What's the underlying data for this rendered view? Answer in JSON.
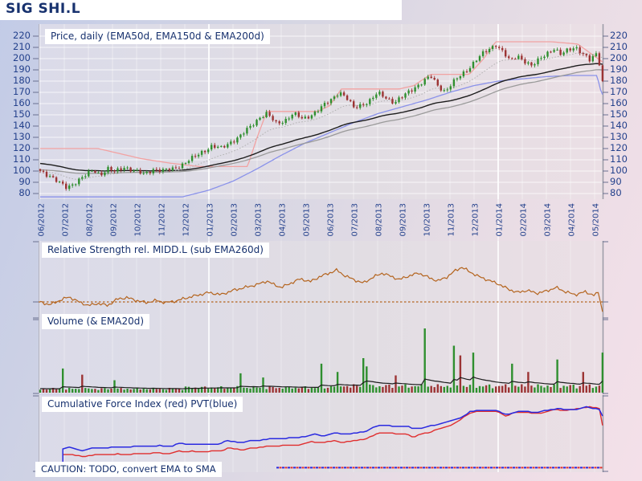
{
  "title": "SIG SHI.L",
  "caution": "CAUTION: TODO, convert EMA to SMA",
  "axis": {
    "months": [
      "06/2012",
      "07/2012",
      "08/2012",
      "09/2012",
      "10/2012",
      "11/2012",
      "12/2012",
      "01/2013",
      "02/2013",
      "03/2013",
      "04/2013",
      "05/2013",
      "06/2013",
      "07/2013",
      "08/2013",
      "09/2013",
      "10/2013",
      "11/2013",
      "12/2013",
      "01/2014",
      "02/2014",
      "03/2014",
      "04/2014",
      "05/2014"
    ],
    "months_span": 23.33,
    "year_boundaries": [
      7,
      19
    ]
  },
  "colors": {
    "up": "#2f8f2f",
    "down": "#9c3434",
    "high_envelope": "#f2a2a2",
    "low_envelope": "#8a92ea",
    "ema50": "#b0b0b0",
    "ema150": "#1d1d1d",
    "ema200": "#9a9a9a",
    "rs_line": "#b4641e",
    "cfi_red": "#e02e2e",
    "pvt_blue": "#2a2ae0",
    "volume_ema": "#1d1d1d",
    "axis_text": "#24418c",
    "label_text": "#17316e"
  },
  "chart_data": [
    {
      "id": "price",
      "type": "candlestick",
      "title": "Price, daily (EMA50d, EMA150d & EMA200d)",
      "ylim": [
        75,
        228
      ],
      "y_ticks": [
        220,
        210,
        200,
        190,
        180,
        170,
        160,
        150,
        140,
        130,
        120,
        110,
        100,
        90,
        80
      ],
      "close_anchors": [
        [
          0,
          100
        ],
        [
          0.4,
          96
        ],
        [
          0.8,
          89
        ],
        [
          1.1,
          85
        ],
        [
          1.5,
          91
        ],
        [
          1.9,
          96
        ],
        [
          2.2,
          101
        ],
        [
          2.5,
          97
        ],
        [
          2.8,
          102
        ],
        [
          3.1,
          99
        ],
        [
          3.5,
          104
        ],
        [
          3.9,
          100
        ],
        [
          4.3,
          97
        ],
        [
          4.7,
          102
        ],
        [
          5.1,
          100
        ],
        [
          5.5,
          102
        ],
        [
          5.9,
          106
        ],
        [
          6.3,
          111
        ],
        [
          6.7,
          117
        ],
        [
          7.1,
          122
        ],
        [
          7.5,
          120
        ],
        [
          7.9,
          126
        ],
        [
          8.3,
          131
        ],
        [
          8.7,
          139
        ],
        [
          9.1,
          148
        ],
        [
          9.4,
          151
        ],
        [
          9.8,
          142
        ],
        [
          10.2,
          146
        ],
        [
          10.5,
          151
        ],
        [
          10.9,
          146
        ],
        [
          11.3,
          151
        ],
        [
          11.7,
          157
        ],
        [
          12.1,
          164
        ],
        [
          12.4,
          171
        ],
        [
          12.7,
          165
        ],
        [
          13.0,
          156
        ],
        [
          13.3,
          159
        ],
        [
          13.7,
          163
        ],
        [
          14.0,
          169
        ],
        [
          14.3,
          166
        ],
        [
          14.7,
          161
        ],
        [
          15.1,
          167
        ],
        [
          15.5,
          174
        ],
        [
          15.9,
          180
        ],
        [
          16.2,
          184
        ],
        [
          16.5,
          176
        ],
        [
          16.8,
          171
        ],
        [
          17.1,
          178
        ],
        [
          17.4,
          184
        ],
        [
          17.7,
          190
        ],
        [
          18.0,
          197
        ],
        [
          18.3,
          203
        ],
        [
          18.6,
          208
        ],
        [
          18.9,
          213
        ],
        [
          19.2,
          206
        ],
        [
          19.5,
          197
        ],
        [
          19.8,
          203
        ],
        [
          20.1,
          198
        ],
        [
          20.4,
          193
        ],
        [
          20.7,
          199
        ],
        [
          21.0,
          205
        ],
        [
          21.3,
          209
        ],
        [
          21.6,
          203
        ],
        [
          21.9,
          208
        ],
        [
          22.2,
          211
        ],
        [
          22.5,
          204
        ],
        [
          22.8,
          198
        ],
        [
          23.0,
          203
        ],
        [
          23.1,
          205
        ],
        [
          23.2,
          196
        ],
        [
          23.33,
          180
        ]
      ],
      "high_envelope": [
        [
          0,
          120
        ],
        [
          2.4,
          120
        ],
        [
          3.2,
          116
        ],
        [
          4.2,
          111
        ],
        [
          5.4,
          107
        ],
        [
          6.6,
          104
        ],
        [
          8.6,
          104
        ],
        [
          9.0,
          130
        ],
        [
          9.4,
          153
        ],
        [
          11.5,
          153
        ],
        [
          12.0,
          158
        ],
        [
          12.5,
          173
        ],
        [
          14.9,
          173
        ],
        [
          15.5,
          176
        ],
        [
          16.2,
          186
        ],
        [
          17.8,
          186
        ],
        [
          18.4,
          200
        ],
        [
          18.9,
          215
        ],
        [
          21.2,
          215
        ],
        [
          22.3,
          213
        ],
        [
          23.33,
          197
        ]
      ],
      "low_envelope": [
        [
          0,
          77
        ],
        [
          5.9,
          77
        ],
        [
          7,
          83
        ],
        [
          8,
          91
        ],
        [
          9,
          102
        ],
        [
          10,
          114
        ],
        [
          11,
          125
        ],
        [
          12,
          134
        ],
        [
          13,
          143
        ],
        [
          14,
          151
        ],
        [
          15,
          157
        ],
        [
          16,
          163
        ],
        [
          17,
          170
        ],
        [
          18,
          176
        ],
        [
          19,
          180
        ],
        [
          20,
          182
        ],
        [
          21,
          184
        ],
        [
          22,
          185
        ],
        [
          23.1,
          185
        ],
        [
          23.25,
          172
        ],
        [
          23.33,
          168
        ]
      ],
      "ema_periods": [
        50,
        150,
        200
      ]
    },
    {
      "id": "relative_strength",
      "type": "line",
      "title": "Relative Strength rel. MIDD.L (sub EMA260d)",
      "baseline": 20,
      "anchors": [
        [
          0,
          20
        ],
        [
          0.4,
          16
        ],
        [
          0.8,
          22
        ],
        [
          1.2,
          27
        ],
        [
          1.6,
          20
        ],
        [
          2,
          15
        ],
        [
          2.4,
          18
        ],
        [
          2.8,
          15
        ],
        [
          3.2,
          24
        ],
        [
          3.6,
          26
        ],
        [
          4,
          22
        ],
        [
          4.4,
          19
        ],
        [
          4.8,
          22
        ],
        [
          5.2,
          19
        ],
        [
          5.6,
          21
        ],
        [
          6,
          25
        ],
        [
          6.5,
          29
        ],
        [
          7,
          33
        ],
        [
          7.5,
          30
        ],
        [
          8,
          36
        ],
        [
          8.5,
          40
        ],
        [
          9,
          44
        ],
        [
          9.4,
          49
        ],
        [
          9.7,
          44
        ],
        [
          10,
          40
        ],
        [
          10.4,
          46
        ],
        [
          10.8,
          52
        ],
        [
          11.2,
          48
        ],
        [
          11.6,
          55
        ],
        [
          12,
          60
        ],
        [
          12.3,
          64
        ],
        [
          12.6,
          57
        ],
        [
          13,
          51
        ],
        [
          13.4,
          46
        ],
        [
          13.8,
          54
        ],
        [
          14.2,
          60
        ],
        [
          14.5,
          56
        ],
        [
          14.9,
          51
        ],
        [
          15.3,
          56
        ],
        [
          15.7,
          60
        ],
        [
          16.1,
          54
        ],
        [
          16.5,
          49
        ],
        [
          16.9,
          55
        ],
        [
          17.2,
          63
        ],
        [
          17.5,
          68
        ],
        [
          17.8,
          62
        ],
        [
          18.2,
          55
        ],
        [
          18.6,
          50
        ],
        [
          19,
          45
        ],
        [
          19.4,
          38
        ],
        [
          19.8,
          33
        ],
        [
          20.2,
          36
        ],
        [
          20.6,
          32
        ],
        [
          21,
          35
        ],
        [
          21.4,
          40
        ],
        [
          21.8,
          34
        ],
        [
          22.2,
          30
        ],
        [
          22.6,
          34
        ],
        [
          23.0,
          29
        ],
        [
          23.15,
          33
        ],
        [
          23.25,
          20
        ],
        [
          23.33,
          6
        ]
      ]
    },
    {
      "id": "volume",
      "type": "bar",
      "title": "Volume (& EMA20d)",
      "spikes": [
        [
          0.9,
          35,
          "g"
        ],
        [
          1.7,
          26,
          "r"
        ],
        [
          3.1,
          18,
          "g"
        ],
        [
          8.3,
          28,
          "g"
        ],
        [
          9.2,
          22,
          "g"
        ],
        [
          11.6,
          42,
          "g"
        ],
        [
          12.3,
          30,
          "g"
        ],
        [
          13.4,
          50,
          "g"
        ],
        [
          13.6,
          38,
          "g"
        ],
        [
          14.8,
          25,
          "r"
        ],
        [
          16.0,
          93,
          "g"
        ],
        [
          17.2,
          68,
          "g"
        ],
        [
          17.4,
          54,
          "r"
        ],
        [
          17.9,
          58,
          "g"
        ],
        [
          19.6,
          42,
          "g"
        ],
        [
          20.3,
          30,
          "r"
        ],
        [
          21.5,
          48,
          "g"
        ],
        [
          22.5,
          30,
          "r"
        ],
        [
          23.3,
          58,
          "g"
        ]
      ]
    },
    {
      "id": "cfi_pvt",
      "type": "line",
      "title": "Cumulative Force Index (red) PVT(blue)",
      "anchors_blue_red": [
        [
          0.85,
          30,
          21
        ],
        [
          1.3,
          32,
          23
        ],
        [
          1.7,
          28,
          19
        ],
        [
          2.2,
          31,
          22
        ],
        [
          3,
          32,
          22
        ],
        [
          3.8,
          33,
          23
        ],
        [
          4.6,
          34,
          24
        ],
        [
          5.4,
          34,
          24
        ],
        [
          5.8,
          37,
          27
        ],
        [
          6.6,
          36,
          26
        ],
        [
          7.4,
          37,
          27
        ],
        [
          7.8,
          41,
          31
        ],
        [
          8.4,
          39,
          29
        ],
        [
          9,
          42,
          32
        ],
        [
          9.6,
          44,
          34
        ],
        [
          10.2,
          45,
          35
        ],
        [
          10.8,
          46,
          36
        ],
        [
          11.3,
          50,
          40
        ],
        [
          11.8,
          48,
          38
        ],
        [
          12.2,
          52,
          42
        ],
        [
          12.6,
          50,
          38
        ],
        [
          13,
          52,
          42
        ],
        [
          13.5,
          53,
          43
        ],
        [
          13.9,
          62,
          51
        ],
        [
          14.6,
          62,
          52
        ],
        [
          15.2,
          61,
          50
        ],
        [
          15.5,
          58,
          47
        ],
        [
          16,
          60,
          52
        ],
        [
          16.5,
          64,
          57
        ],
        [
          17,
          68,
          63
        ],
        [
          17.4,
          72,
          69
        ],
        [
          17.8,
          81,
          80
        ],
        [
          18.2,
          83,
          82
        ],
        [
          18.6,
          84,
          83
        ],
        [
          19,
          82,
          81
        ],
        [
          19.3,
          78,
          76
        ],
        [
          19.7,
          81,
          80
        ],
        [
          20.2,
          82,
          81
        ],
        [
          20.6,
          80,
          78
        ],
        [
          21,
          83,
          82
        ],
        [
          21.4,
          86,
          85
        ],
        [
          21.8,
          84,
          83
        ],
        [
          22.2,
          85,
          85
        ],
        [
          22.6,
          88,
          88
        ],
        [
          23,
          86,
          87
        ],
        [
          23.15,
          87,
          88
        ],
        [
          23.25,
          84,
          83
        ],
        [
          23.33,
          76,
          63
        ]
      ],
      "dotted_baseline": {
        "from_month": 9.8,
        "value": 4
      }
    }
  ]
}
